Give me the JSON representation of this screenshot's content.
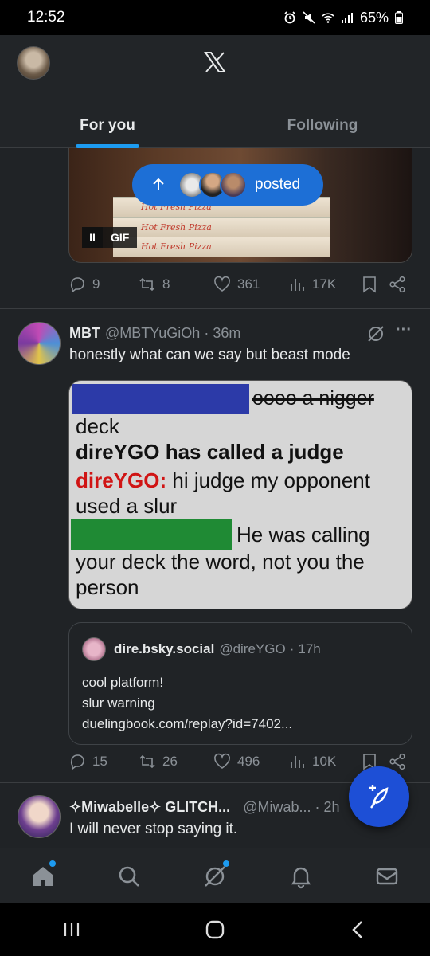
{
  "status": {
    "time": "12:52",
    "battery": "65%"
  },
  "header": {
    "logo": "X",
    "tabs": [
      {
        "label": "For you",
        "active": true
      },
      {
        "label": "Following",
        "active": false
      }
    ]
  },
  "post1": {
    "gif_label": "GIF",
    "pause_symbol": "II",
    "box_text": "Hot Fresh Pizza",
    "posted_label": "posted",
    "stats": {
      "replies": "9",
      "reposts": "8",
      "likes": "361",
      "views": "17K"
    }
  },
  "post2": {
    "name": "MBT",
    "handle": "@MBTYuGiOh",
    "separator": "·",
    "time": "36m",
    "text": "honestly what can we say but beast mode",
    "image": {
      "line1": "oooo a nigger",
      "line2": "deck",
      "line3": "direYGO has called a judge",
      "line4_name": "direYGO:",
      "line4_rest": " hi judge my opponent",
      "line5": "used a slur",
      "line6": "He was calling",
      "line7": "your deck the word, not you the",
      "line8": "person"
    },
    "quote": {
      "name": "dire.bsky.social",
      "handle": "@direYGO",
      "separator": "·",
      "time": "17h",
      "lines": [
        "cool platform!",
        "slur warning",
        "duelingbook.com/replay?id=7402..."
      ]
    },
    "stats": {
      "replies": "15",
      "reposts": "26",
      "likes": "496",
      "views": "10K"
    }
  },
  "post3": {
    "name": "✧Miwabelle✧ GLITCH...",
    "handle": "@Miwab...",
    "separator": "·",
    "time": "2h",
    "text": "I will never stop saying it."
  },
  "colors": {
    "accent": "#1d9bf0",
    "fab": "#1d4fd6",
    "background": "#202326"
  }
}
